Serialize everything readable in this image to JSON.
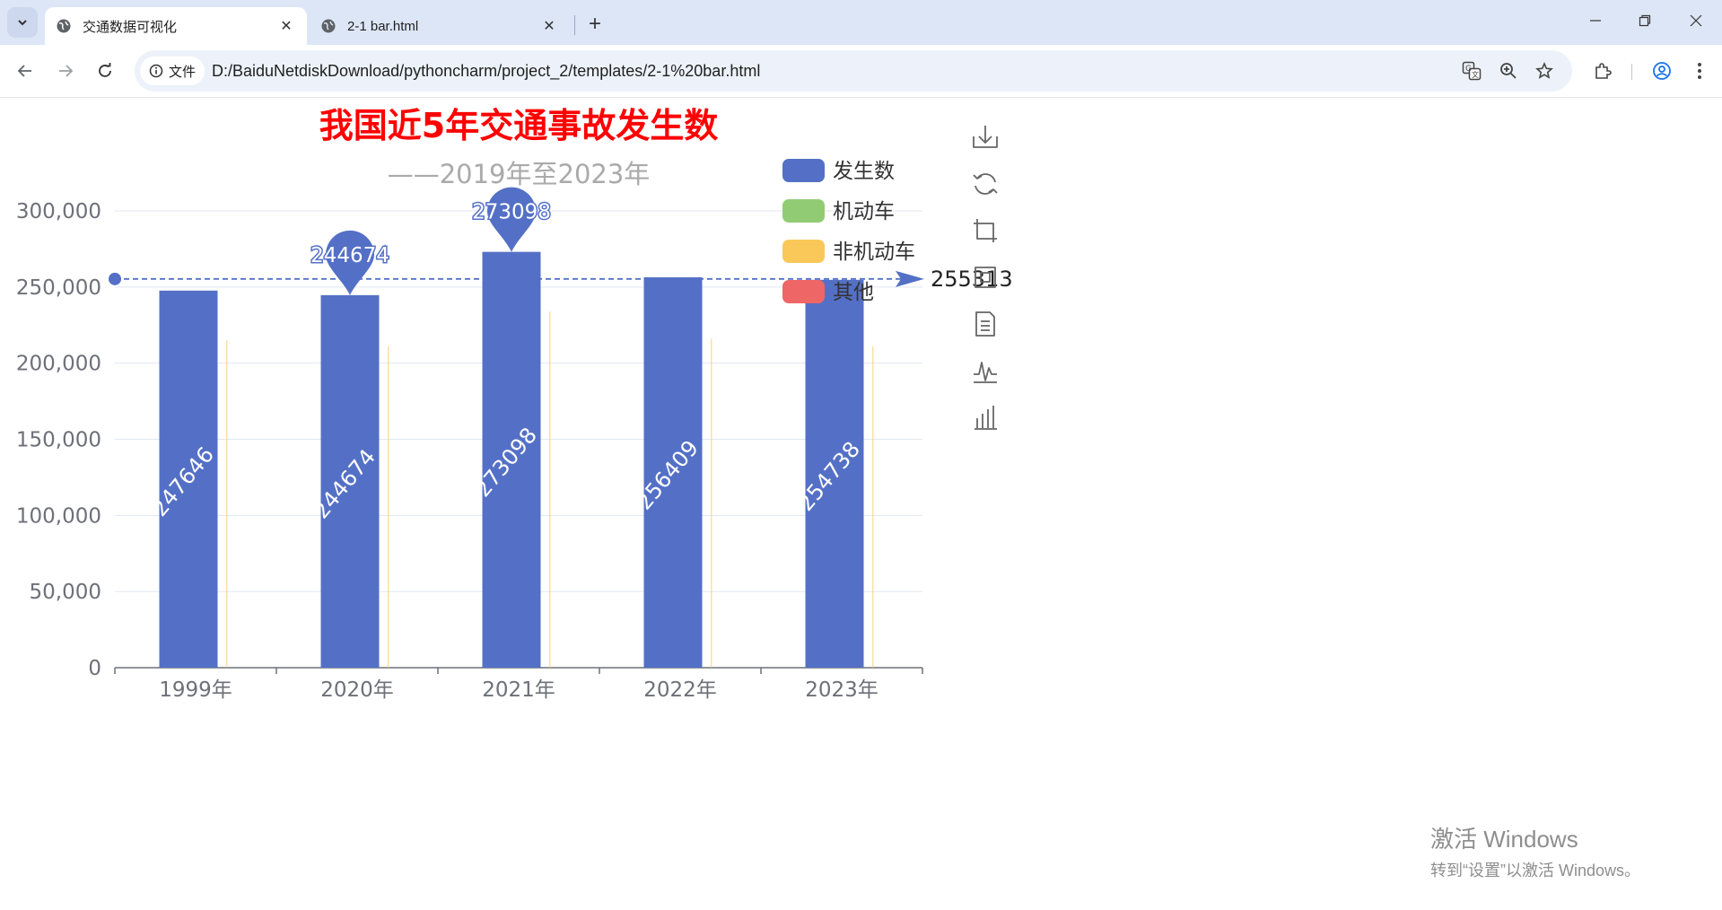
{
  "browser": {
    "tabs": [
      {
        "title": "交通数据可视化",
        "active": true
      },
      {
        "title": "2-1 bar.html",
        "active": false
      }
    ],
    "address_chip": "文件",
    "url": "D:/BaiduNetdiskDownload/pythoncharm/project_2/templates/2-1%20bar.html"
  },
  "toolbox": {
    "icons": [
      "save-as-image-icon",
      "restore-icon",
      "data-zoom-icon",
      "zoom-reset-icon",
      "data-view-icon",
      "line-switch-icon",
      "bar-switch-icon"
    ]
  },
  "watermark": {
    "title": "激活 Windows",
    "subtitle": "转到“设置”以激活 Windows。"
  },
  "chart_data": {
    "type": "bar",
    "title": "我国近5年交通事故发生数",
    "subtitle": "——2019年至2023年",
    "title_color": "#ff0000",
    "categories": [
      "1999年",
      "2020年",
      "2021年",
      "2022年",
      "2023年"
    ],
    "series": [
      {
        "name": "发生数",
        "color": "#5470c6",
        "values": [
          247646,
          244674,
          273098,
          256409,
          254738
        ]
      },
      {
        "name": "机动车",
        "color": "#91cc75",
        "values": [
          null,
          null,
          null,
          null,
          null
        ]
      },
      {
        "name": "非机动车",
        "color": "#fac858",
        "values": [
          215000,
          211000,
          234000,
          216000,
          211000
        ]
      },
      {
        "name": "其他",
        "color": "#ee6666",
        "values": [
          null,
          null,
          null,
          null,
          null
        ]
      }
    ],
    "mark_points": [
      {
        "label": "244674",
        "category": "2020年",
        "value": 244674
      },
      {
        "label": "273098",
        "category": "2021年",
        "value": 273098
      }
    ],
    "mark_line": {
      "label": "255313",
      "value": 255313
    },
    "y_ticks": [
      "0",
      "50,000",
      "100,000",
      "150,000",
      "200,000",
      "250,000",
      "300,000"
    ],
    "ylim": [
      0,
      300000
    ],
    "grid": true,
    "legend_position": "top-right"
  }
}
